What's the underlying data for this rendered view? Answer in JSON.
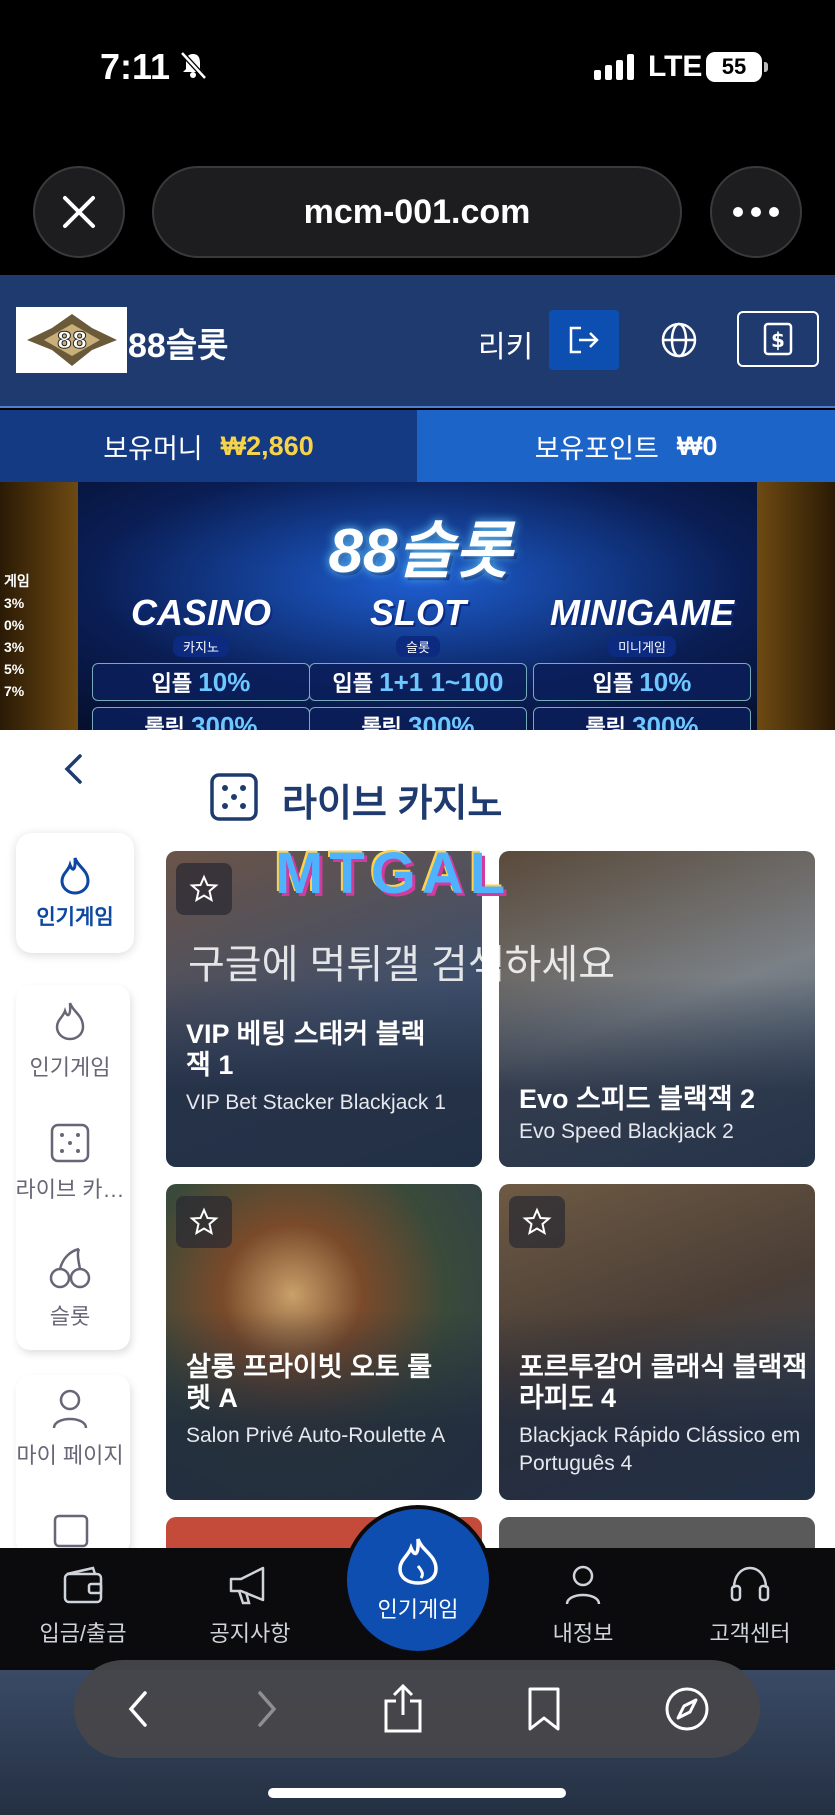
{
  "status_bar": {
    "time": "7:11",
    "network": "LTE",
    "battery": "55"
  },
  "browser": {
    "url": "mcm-001.com"
  },
  "header": {
    "site_name": "88슬롯",
    "user_name": "리키",
    "balance_label": "보유머니",
    "balance_value": "₩2,860",
    "points_label": "보유포인트",
    "points_value": "₩0"
  },
  "banner": {
    "title": "88슬롯",
    "promos": [
      {
        "name": "CASINO",
        "sub": "카지노",
        "rows": [
          [
            "입플",
            "10%"
          ],
          [
            "롤링",
            "300%"
          ]
        ]
      },
      {
        "name": "SLOT",
        "sub": "슬롯",
        "rows": [
          [
            "입플",
            "1+1 1~100"
          ],
          [
            "롤링",
            "300%"
          ]
        ]
      },
      {
        "name": "MINIGAME",
        "sub": "미니게임",
        "rows": [
          [
            "입플",
            "10%"
          ],
          [
            "롤링",
            "300%"
          ]
        ]
      }
    ],
    "side_list": [
      "게임",
      "3%",
      "0%",
      "3%",
      "5%",
      "7%"
    ]
  },
  "section": {
    "title": "라이브 카지노"
  },
  "left_nav": {
    "active": "인기게임",
    "items": [
      "인기게임",
      "라이브 카…",
      "슬롯"
    ],
    "items2": [
      "마이 페이지"
    ]
  },
  "watermark": {
    "logo": "MTGAL",
    "text": "구글에 먹튀갤 검색하세요"
  },
  "games": [
    {
      "title": "VIP 베팅 스태커 블랙잭 1",
      "subtitle": "VIP Bet Stacker Blackjack 1"
    },
    {
      "title": "Evo 스피드 블랙잭 2",
      "subtitle": "Evo Speed Blackjack 2"
    },
    {
      "title": "살롱 프라이빗 오토 룰렛 A",
      "subtitle": "Salon Privé Auto-Roulette A"
    },
    {
      "title": "포르투갈어 클래식 블랙잭 라피도 4",
      "subtitle": "Blackjack Rápido Clássico em Português 4"
    }
  ],
  "tabbar": {
    "deposit": "입금/출금",
    "notice": "공지사항",
    "popular": "인기게임",
    "myinfo": "내정보",
    "support": "고객센터"
  },
  "colors": {
    "header": "#1f3a6e",
    "accent": "#0e4eb0",
    "money": "#f7d34a"
  }
}
